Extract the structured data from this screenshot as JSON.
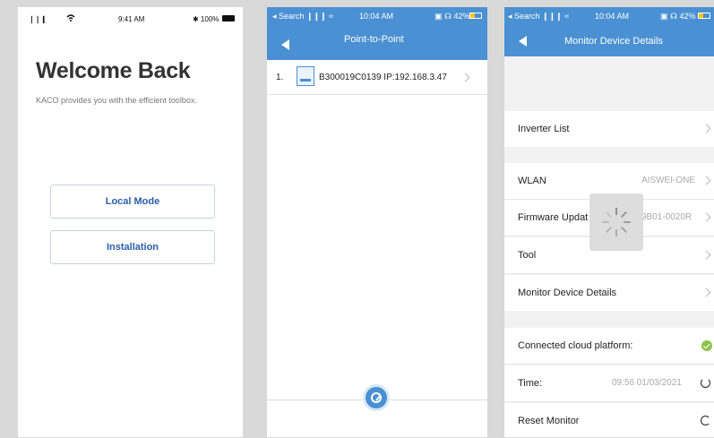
{
  "panel1": {
    "status": {
      "signal": "❘❘❙",
      "wifi": "wifi",
      "time": "9:41 AM",
      "battery": "✱ 100%"
    },
    "welcome": "Welcome Back",
    "subtitle": "KACO provides you with the efficient toolbox.",
    "buttons": {
      "local": "Local Mode",
      "install": "Installation"
    }
  },
  "panel2": {
    "status": {
      "left": "◂ Search ❙❙❙ ≈",
      "time": "10:04 AM",
      "right": "▣ ☊ 42%"
    },
    "title": "Point-to-Point",
    "device": {
      "index": "1.",
      "text": "B300019C0139 IP:192.168.3.47"
    }
  },
  "panel3": {
    "status": {
      "left": "◂ Search ❙❙❙ ≈",
      "time": "10:04 AM",
      "right": "▣ ☊ 42%"
    },
    "title": "Monitor Device Details",
    "rows": {
      "inverter_list": "Inverter List",
      "wlan": "WLAN",
      "wlan_value": "AISWEI-ONE",
      "firmware": "Firmware Updat",
      "firmware_value": "9B01-0020R",
      "tool": "Tool",
      "monitor_details": "Monitor Device Details",
      "cloud": "Connected cloud platform:",
      "time": "Time:",
      "time_value": "09:56 01/03/2021",
      "reset": "Reset Monitor"
    }
  },
  "colors": {
    "accent": "#4a90d3",
    "button_text": "#2a5ea8",
    "success": "#8bc34a"
  }
}
